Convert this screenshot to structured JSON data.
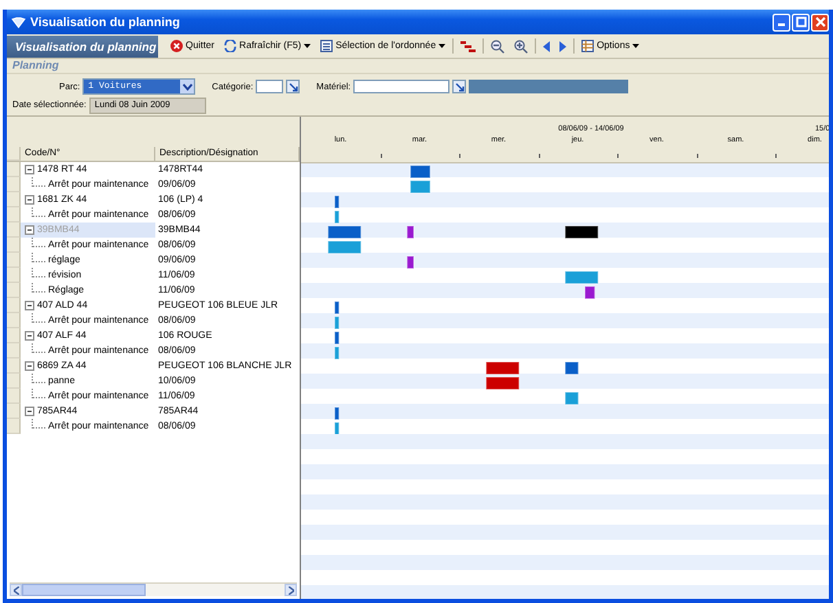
{
  "window": {
    "title": "Visualisation du planning"
  },
  "toolbar": {
    "title": "Visualisation du planning",
    "buttons": [
      {
        "label": "Quitter",
        "menu": false
      },
      {
        "label": "Rafraîchir (F5)",
        "menu": true
      },
      {
        "label": "Sélection de l'ordonnée",
        "menu": true
      }
    ],
    "options": {
      "label": "Options",
      "menu": true
    }
  },
  "section": "Planning",
  "filters": {
    "parc": {
      "label": "Parc:",
      "value": "1 Voitures"
    },
    "categorie": {
      "label": "Catégorie:"
    },
    "materiel": {
      "label": "Matériel:"
    },
    "date": {
      "label": "Date sélectionnée:",
      "value": "Lundi 08 Juin 2009"
    }
  },
  "gantt": {
    "range": "08/06/09 - 14/06/09",
    "next_range": "15/0",
    "days": [
      "lun.",
      "mar.",
      "mer.",
      "jeu.",
      "ven.",
      "sam.",
      "dim."
    ],
    "columns": [
      "Code/N°",
      "Description/Désignation"
    ],
    "rows": [
      {
        "code": "1478 RT 44",
        "description": "1478RT44",
        "expanded": true,
        "selected": false,
        "children": [
          {
            "code": "Arrêt pour maintenance",
            "description": "09/06/09",
            "selected": false
          }
        ]
      },
      {
        "code": "1681 ZK 44",
        "description": "106 (LP) 4",
        "expanded": true,
        "selected": false,
        "children": [
          {
            "code": "Arrêt pour maintenance",
            "description": "08/06/09",
            "selected": false
          }
        ]
      },
      {
        "code": "39BMB44",
        "description": "39BMB44",
        "expanded": true,
        "selected": true,
        "children": [
          {
            "code": "Arrêt pour maintenance",
            "description": "08/06/09",
            "selected": false
          },
          {
            "code": "réglage",
            "description": "09/06/09",
            "selected": false
          },
          {
            "code": "révision",
            "description": "11/06/09",
            "selected": false
          },
          {
            "code": "Réglage",
            "description": "11/06/09",
            "selected": false
          }
        ]
      },
      {
        "code": "407 ALD 44",
        "description": "PEUGEOT 106 BLEUE JLR",
        "expanded": true,
        "selected": false,
        "children": [
          {
            "code": "Arrêt pour maintenance",
            "description": "08/06/09",
            "selected": false
          }
        ]
      },
      {
        "code": "407 ALF 44",
        "description": "106 ROUGE",
        "expanded": true,
        "selected": false,
        "children": [
          {
            "code": "Arrêt pour maintenance",
            "description": "08/06/09",
            "selected": false
          }
        ]
      },
      {
        "code": "6869 ZA 44",
        "description": "PEUGEOT 106 BLANCHE JLR",
        "expanded": true,
        "selected": false,
        "children": [
          {
            "code": "panne",
            "description": "10/06/09",
            "selected": false
          },
          {
            "code": "Arrêt pour maintenance",
            "description": "11/06/09",
            "selected": false
          }
        ]
      },
      {
        "code": "785AR44",
        "description": "785AR44",
        "expanded": true,
        "selected": false,
        "children": [
          {
            "code": "Arrêt pour maintenance",
            "description": "08/06/09",
            "selected": false
          }
        ]
      }
    ]
  }
}
